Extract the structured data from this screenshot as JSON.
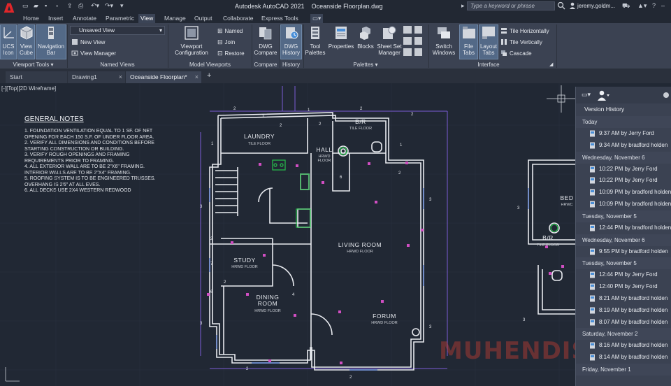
{
  "app": {
    "title": "Autodesk AutoCAD 2021",
    "document": "Oceanside Floorplan.dwg",
    "search_placeholder": "Type a keyword or phrase",
    "user": "jeremy.goldm..."
  },
  "ribbon_tabs": [
    "Home",
    "Insert",
    "Annotate",
    "Parametric",
    "View",
    "Manage",
    "Output",
    "Collaborate",
    "Express Tools"
  ],
  "active_tab": "View",
  "ribbon": {
    "viewport_tools": {
      "label": "Viewport Tools",
      "ucs_icon": "UCS Icon",
      "view_cube": "View Cube",
      "navigation_bar": "Navigation Bar"
    },
    "named_views": {
      "label": "Named Views",
      "current": "Unsaved View",
      "new_view": "New View",
      "view_manager": "View Manager"
    },
    "model_viewports": {
      "label": "Model Viewports",
      "viewport_configuration": "Viewport Configuration",
      "named": "Named",
      "join": "Join",
      "restore": "Restore"
    },
    "compare": {
      "label": "Compare",
      "dwg_compare": "DWG Compare"
    },
    "history": {
      "label": "History",
      "dwg_history": "DWG History"
    },
    "palettes": {
      "label": "Palettes",
      "tool_palettes": "Tool Palettes",
      "properties": "Properties",
      "blocks": "Blocks",
      "sheet_set_manager": "Sheet Set Manager"
    },
    "interface": {
      "label": "Interface",
      "switch_windows": "Switch Windows",
      "file_tabs": "File Tabs",
      "layout_tabs": "Layout Tabs",
      "tile_horizontally": "Tile Horizontally",
      "tile_vertically": "Tile Vertically",
      "cascade": "Cascade"
    }
  },
  "file_tabs": [
    "Start",
    "Drawing1",
    "Oceanside Floorplan*"
  ],
  "viewport_label": "[-][Top][2D Wireframe]",
  "general_notes": {
    "title": "GENERAL NOTES",
    "items": [
      "1.   FOUNDATION VENTILATION EQUAL TO 1 SF. OF NET",
      "      OPENING FOR EACH 150 S.F. OF UNDER FLOOR AREA.",
      "2.   VERIFY ALL DIMENSIONS AND CONDITIONS BEFORE",
      "      STARTING CONSTRUCTION OR BUILDING.",
      "3.   VERIFY ROUGH OPENINGS AND FRAMING",
      "      REQUIREMENTS PRIOR TO FRAMING.",
      "4.   ALL EXTERIOR WALL ARE TO BE 2\"X6\" FRAMING.",
      "      INTERIOR WALLS ARE TO BE 2\"X4\" FRAMING.",
      "5.   ROOFING SYSTEM IS TO BE ENGINEERED TRUSSES.",
      "      OVERHANG IS 2'6\" AT ALL EVES.",
      "6.   ALL DECKS USE 2X4 WESTERN REDWOOD"
    ]
  },
  "rooms": [
    {
      "name": "LAUNDRY",
      "sub": "TILE FLOOR"
    },
    {
      "name": "B/R",
      "sub": "TILE FLOOR"
    },
    {
      "name": "HALL",
      "sub": "HRWD FLOOR"
    },
    {
      "name": "STUDY",
      "sub": "HRWD FLOOR"
    },
    {
      "name": "LIVING ROOM",
      "sub": "HRWD FLOOR"
    },
    {
      "name": "DINING ROOM",
      "sub": "HRWD FLOOR"
    },
    {
      "name": "FORUM",
      "sub": "HRWD FLOOR"
    },
    {
      "name": "BED",
      "sub": "HRWC"
    },
    {
      "name": "B/R",
      "sub": "TILE FLOOR"
    }
  ],
  "version_history": {
    "title": "Version History",
    "groups": [
      {
        "date": "Today",
        "items": [
          "9:37 AM by Jerry Ford",
          "9:34 AM by bradford holden"
        ]
      },
      {
        "date": "Wednesday, November 6",
        "items": [
          "10:22 PM by Jerry Ford",
          "10:22 PM by Jerry Ford",
          "10:09 PM by bradford holden",
          "10:09 PM by bradford holden"
        ]
      },
      {
        "date": "Tuesday, November 5",
        "items": [
          "12:44 PM by bradford holden"
        ]
      },
      {
        "date": "Wednesday, November 6",
        "items": [
          "9:55 PM by bradford holden"
        ]
      },
      {
        "date": "Tuesday, November 5",
        "items": [
          "12:44 PM by Jerry Ford",
          "12:40 PM by Jerry Ford",
          "8:21 AM by bradford holden",
          "8:19 AM by bradford holden",
          "8:07 AM by bradford holden"
        ]
      },
      {
        "date": "Saturday, November 2",
        "items": [
          "8:16 AM by bradford holden",
          "8:14 AM by bradford holden"
        ]
      },
      {
        "date": "Friday, November 1",
        "items": []
      }
    ]
  },
  "watermark": "MUHENDIS",
  "colors": {
    "accent": "#536987",
    "canvas": "#212834",
    "walls": "#e8eaef",
    "purple": "#8b5cf6",
    "logo": "#e0262a"
  }
}
